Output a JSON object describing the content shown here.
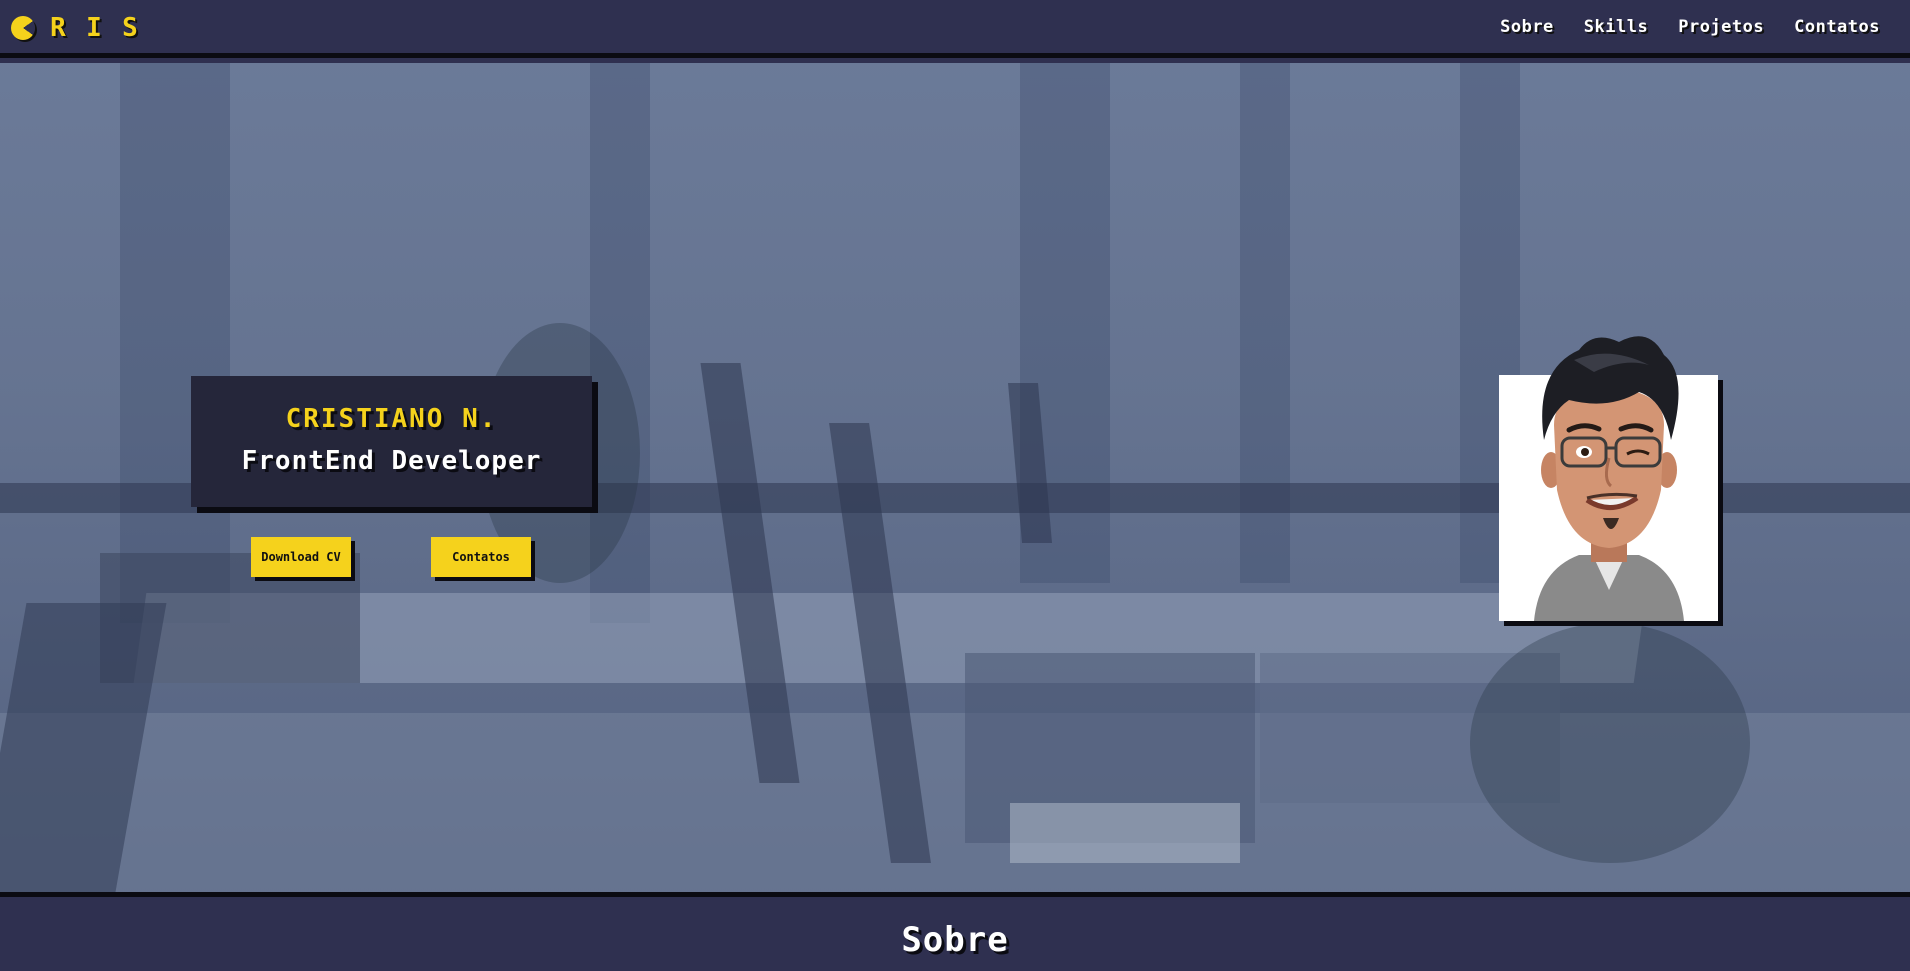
{
  "logo": {
    "letters": [
      "R",
      "I",
      "S"
    ]
  },
  "nav": {
    "items": [
      {
        "label": "Sobre"
      },
      {
        "label": "Skills"
      },
      {
        "label": "Projetos"
      },
      {
        "label": "Contatos"
      }
    ]
  },
  "hero": {
    "name": "CRISTIANO N.",
    "role": "FrontEnd Developer",
    "buttons": {
      "download_cv": "Download CV",
      "contacts": "Contatos"
    }
  },
  "section": {
    "title": "Sobre"
  },
  "colors": {
    "accent": "#f5d21c",
    "navbar": "#2f3050",
    "card": "#25263a",
    "shadow": "#0b0b12"
  },
  "icons": {
    "logo_first_letter": "pacman-c-icon"
  }
}
